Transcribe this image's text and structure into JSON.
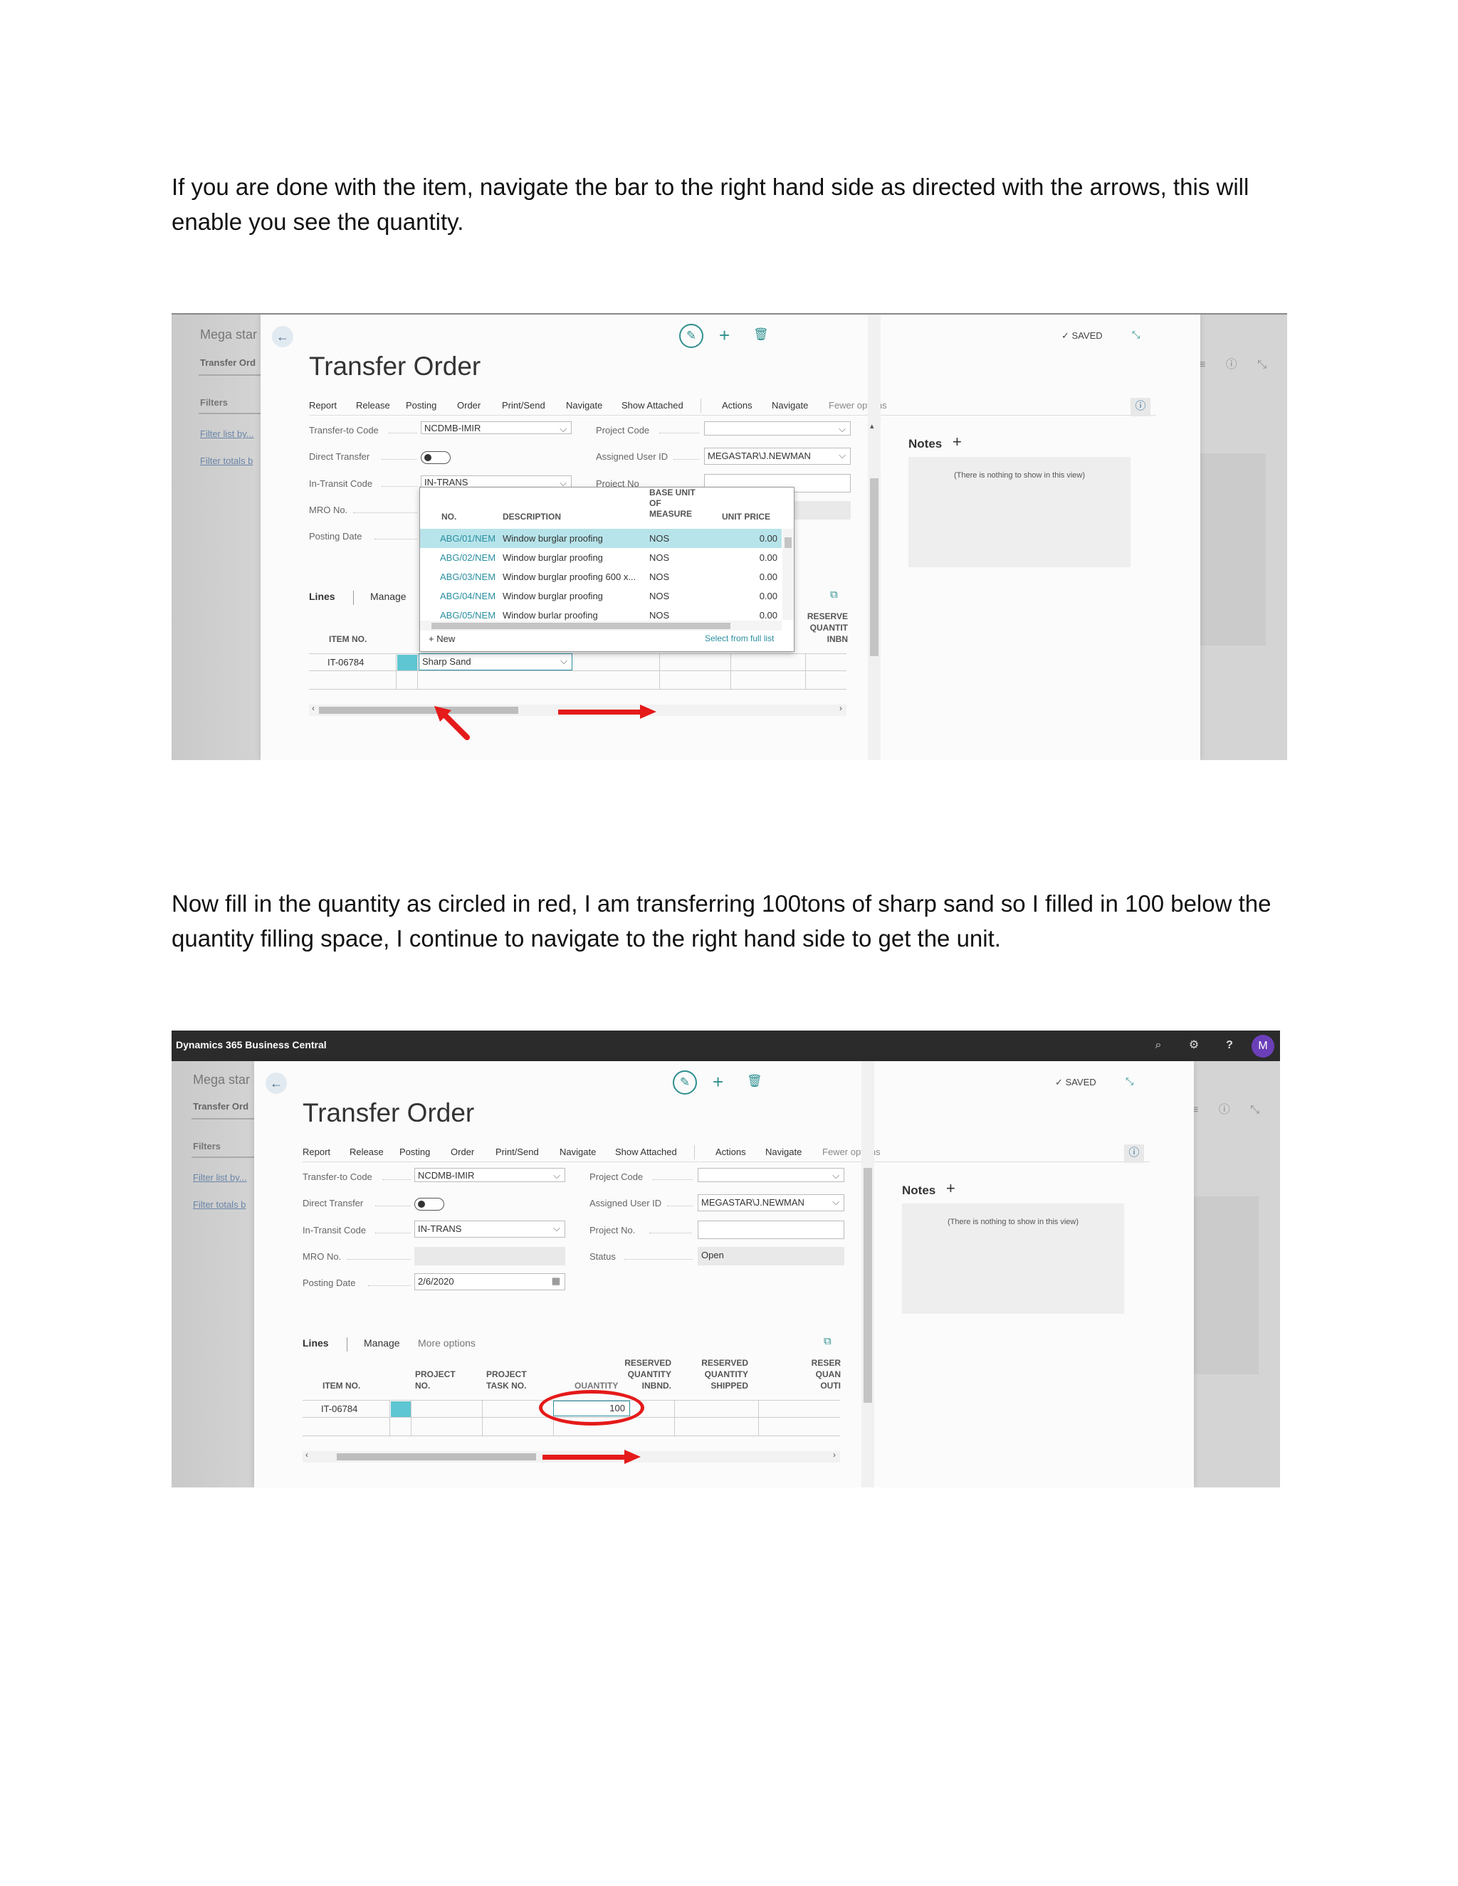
{
  "instructions": {
    "p1": "If you are done with the item, navigate the bar to the right hand side as directed with the arrows, this will enable you see the quantity.",
    "p2": "Now fill in the quantity as circled in red, I am transferring 100tons of sharp sand so I filled in 100 below the quantity filling space, I continue to navigate to the right hand side to get the unit."
  },
  "app": {
    "brand": "Dynamics 365 Business Central",
    "avatar_initial": "M"
  },
  "background": {
    "company": "Mega star",
    "crumb": "Transfer Ord",
    "filters": "Filters",
    "filter_list": "Filter list by...",
    "filter_totals": "Filter totals b"
  },
  "page": {
    "title": "Transfer Order",
    "saved": "SAVED"
  },
  "menu": [
    "Report",
    "Release",
    "Posting",
    "Order",
    "Print/Send",
    "Navigate",
    "Show Attached",
    "Actions",
    "Navigate",
    "Fewer options"
  ],
  "fields": {
    "transfer_to_code_label": "Transfer-to Code",
    "transfer_to_code": "NCDMB-IMIR",
    "direct_transfer_label": "Direct Transfer",
    "in_transit_code_label": "In-Transit Code",
    "in_transit_code": "IN-TRANS",
    "mro_no_label": "MRO No.",
    "posting_date_label": "Posting Date",
    "posting_date": "2/6/2020",
    "project_code_label": "Project Code",
    "assigned_user_label": "Assigned User ID",
    "assigned_user": "MEGASTAR\\J.NEWMAN",
    "project_no_label": "Project No.",
    "project_no_cut": "Project No",
    "status_label": "Status",
    "status": "Open"
  },
  "notes": {
    "title": "Notes",
    "empty": "(There is nothing to show in this view)"
  },
  "lines": {
    "title": "Lines",
    "manage": "Manage",
    "more": "More options"
  },
  "shot1_grid": {
    "item_no_header": "ITEM NO.",
    "reserve_header_1": "RESERVE",
    "reserve_header_2": "QUANTIT",
    "reserve_header_3": "INBN",
    "item_no": "IT-06784",
    "description": "Sharp Sand"
  },
  "dropdown": {
    "headers": {
      "no": "NO.",
      "description": "DESCRIPTION",
      "uom_1": "BASE UNIT",
      "uom_2": "OF",
      "uom_3": "MEASURE",
      "price": "UNIT PRICE"
    },
    "rows": [
      {
        "no": "ABG/01/NEM",
        "description": "Window burglar proofing",
        "uom": "NOS",
        "price": "0.00"
      },
      {
        "no": "ABG/02/NEM",
        "description": "Window burglar proofing",
        "uom": "NOS",
        "price": "0.00"
      },
      {
        "no": "ABG/03/NEM",
        "description": "Window burglar proofing 600 x...",
        "uom": "NOS",
        "price": "0.00"
      },
      {
        "no": "ABG/04/NEM",
        "description": "Window burglar proofing",
        "uom": "NOS",
        "price": "0.00"
      },
      {
        "no": "ABG/05/NEM",
        "description": "Window burlar proofing",
        "uom": "NOS",
        "price": "0.00"
      }
    ],
    "new": "New",
    "select_full": "Select from full list"
  },
  "shot2_grid": {
    "headers": {
      "item_no": "ITEM NO.",
      "project_no_1": "PROJECT",
      "project_no_2": "NO.",
      "project_task_1": "PROJECT",
      "project_task_2": "TASK NO.",
      "quantity": "QUANTITY",
      "res_inbnd_1": "RESERVED",
      "res_inbnd_2": "QUANTITY",
      "res_inbnd_3": "INBND.",
      "res_shipped_1": "RESERVED",
      "res_shipped_2": "QUANTITY",
      "res_shipped_3": "SHIPPED",
      "res_out_1": "RESER",
      "res_out_2": "QUAN",
      "res_out_3": "OUTI"
    },
    "item_no": "IT-06784",
    "quantity": "100"
  },
  "annotation_colors": {
    "arrow": "#e51a1a",
    "circle": "#e51a1a",
    "accent": "#2f8f8f"
  }
}
